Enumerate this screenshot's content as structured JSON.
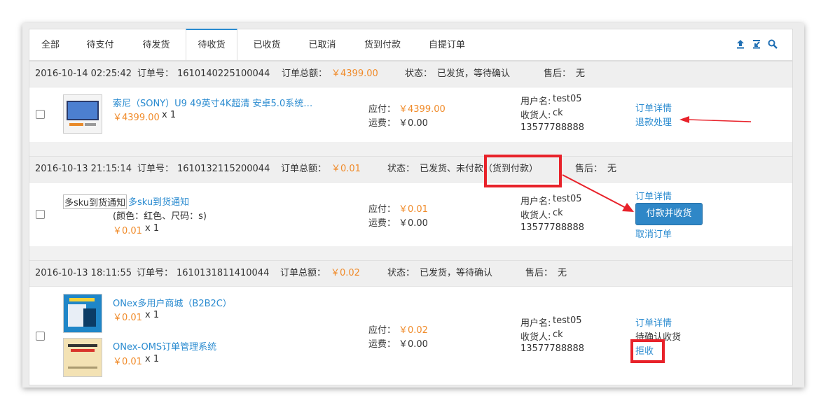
{
  "tabs": [
    "全部",
    "待支付",
    "待发货",
    "待收货",
    "已收货",
    "已取消",
    "货到付款",
    "自提订单"
  ],
  "active_tab": "待收货",
  "toolbar": {
    "icons": [
      "upload-icon",
      "export-icon",
      "search-icon"
    ]
  },
  "labels": {
    "order_no": "订单号：",
    "order_total": "订单总额：",
    "status": "状态：",
    "aftersale": "售后：",
    "payable": "应付：",
    "shipping": "运费：",
    "username": "用户名:",
    "receiver": "收货人:"
  },
  "orders": [
    {
      "time": "2016-10-14 02:25:42",
      "order_no": "1610140225100044",
      "total": "￥4399.00",
      "status": "已发货，等待确认",
      "aftersale": "无",
      "items": [
        {
          "title": "索尼（SONY）U9 49英寸4K超清 安卓5.0系统…",
          "price": "￥4399.00",
          "qty": "x 1"
        }
      ],
      "payable": "￥4399.00",
      "shipping_fee": "￥0.00",
      "username": "test05",
      "receiver": "ck",
      "phone": "13577788888",
      "actions": {
        "detail": "订单详情",
        "refund": "退款处理"
      }
    },
    {
      "time": "2016-10-13 21:15:14",
      "order_no": "1610132115200044",
      "total": "￥0.01",
      "status": "已发货、未付款（货到付款）",
      "aftersale": "无",
      "items": [
        {
          "image_alt": "多sku到货通知",
          "title": "多sku到货通知",
          "variant": "(颜色：红色、尺码：s)",
          "price": "￥0.01",
          "qty": "x 1"
        }
      ],
      "payable": "￥0.01",
      "shipping_fee": "￥0.00",
      "username": "test05",
      "receiver": "ck",
      "phone": "13577788888",
      "actions": {
        "detail": "订单详情",
        "pay_receive": "付款并收货",
        "cancel": "取消订单"
      }
    },
    {
      "time": "2016-10-13 18:11:55",
      "order_no": "1610131811410044",
      "total": "￥0.02",
      "status": "已发货，等待确认",
      "aftersale": "无",
      "items": [
        {
          "title": "ONex多用户商城（B2B2C）",
          "price": "￥0.01",
          "qty": "x 1"
        },
        {
          "title": "ONex-OMS订单管理系统",
          "price": "￥0.01",
          "qty": "x 1"
        }
      ],
      "payable": "￥0.02",
      "shipping_fee": "￥0.00",
      "username": "test05",
      "receiver": "ck",
      "phone": "13577788888",
      "actions": {
        "detail": "订单详情",
        "await": "待确认收货",
        "reject": "拒收"
      }
    }
  ],
  "colors": {
    "link": "#2a8bd0",
    "price": "#f08b2a",
    "annotation": "#e8222a",
    "button": "#2f87c7"
  }
}
